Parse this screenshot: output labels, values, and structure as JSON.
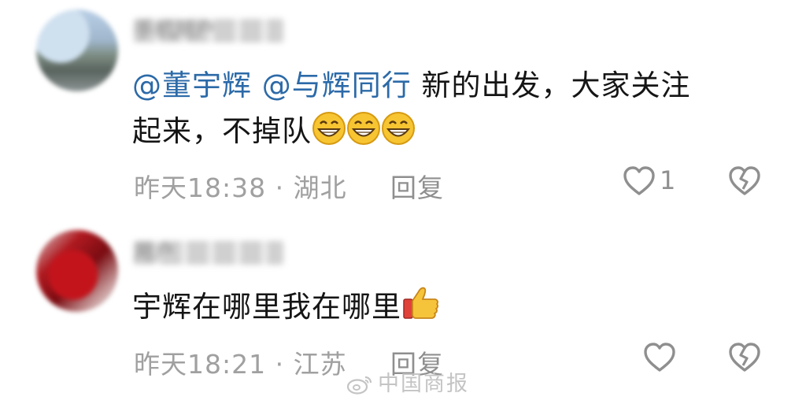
{
  "comments": [
    {
      "username": "手机用户",
      "mentions": [
        "@董宇辉",
        "@与辉同行"
      ],
      "text_line1": "新的出发，大家关注",
      "text_line2": "起来，不掉队",
      "emojis": [
        "grinning-face",
        "grinning-face",
        "grinning-face"
      ],
      "time": "昨天18:38",
      "separator": "·",
      "location": "湖北",
      "reply_label": "回复",
      "like_count": "1"
    },
    {
      "username": "用户",
      "text": "宇辉在哪里我在哪里",
      "emojis": [
        "thumbs-up"
      ],
      "time": "昨天18:21",
      "separator": "·",
      "location": "江苏",
      "reply_label": "回复",
      "like_count": ""
    }
  ],
  "watermark": "中国商报",
  "colors": {
    "mention": "#2c6aa8",
    "text": "#151515",
    "meta": "#a0a0a0",
    "icon": "#8f8f8f"
  }
}
